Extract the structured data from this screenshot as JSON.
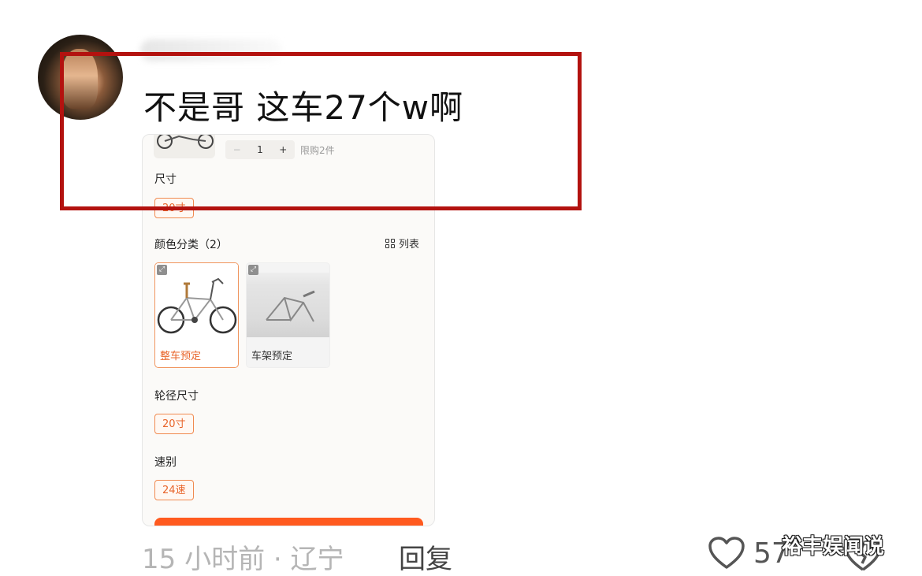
{
  "comment": {
    "text": "不是哥 这车27个w啊",
    "time_location": "15 小时前 · 辽宁",
    "reply_label": "回复",
    "like_count": "57"
  },
  "product_card": {
    "quantity": "1",
    "quantity_minus": "−",
    "quantity_plus": "+",
    "limit_text": "限购2件",
    "size_label": "尺寸",
    "size_value": "20寸",
    "color_label": "颜色分类（2）",
    "list_toggle_label": "列表",
    "options": [
      {
        "name": "整车预定",
        "selected": true
      },
      {
        "name": "车架预定",
        "selected": false
      }
    ],
    "wheel_label": "轮径尺寸",
    "wheel_value": "20寸",
    "speed_label": "速别",
    "speed_value": "24速"
  },
  "highlight": {
    "color": "#b3120f"
  },
  "accent_color": "#e8642a",
  "watermark": "裕丰娱闻说"
}
